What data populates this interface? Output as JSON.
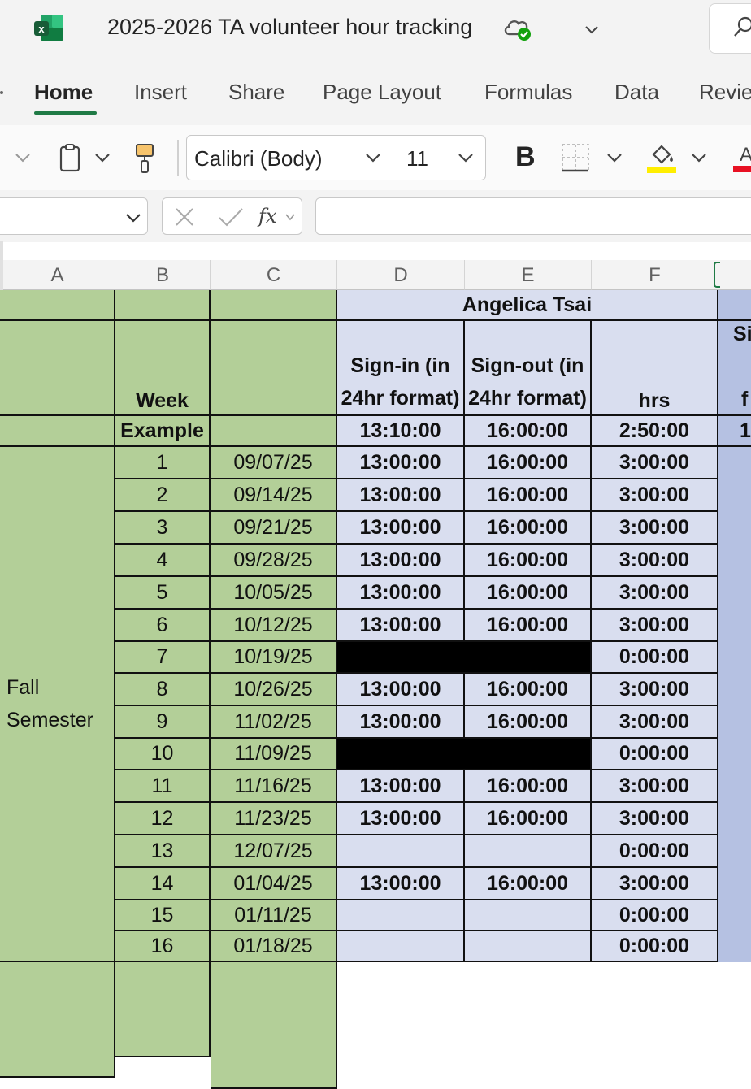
{
  "window": {
    "title": "2025-2026 TA volunteer hour tracking",
    "logo_icon": "excel-logo-icon",
    "sync_icon": "cloud-saved-icon"
  },
  "tabs": [
    "Home",
    "Insert",
    "Share",
    "Page Layout",
    "Formulas",
    "Data",
    "Revie"
  ],
  "active_tab": "Home",
  "ribbon": {
    "font_name": "Calibri (Body)",
    "font_size": "11",
    "bold_label": "B",
    "highlight_color": "#ffee00",
    "font_color": "#e81123",
    "accent": "#1f7a45"
  },
  "formula_bar": {
    "fx_label": "fx",
    "name_box": "",
    "formula": ""
  },
  "columns": [
    "A",
    "B",
    "C",
    "D",
    "E",
    "F"
  ],
  "sheet": {
    "person": "Angelica Tsai",
    "hdr_week": "Week",
    "hdr_signin": "Sign-in (in 24hr format)",
    "hdr_signout": "Sign-out (in 24hr format)",
    "hdr_hrs": "hrs",
    "next_hdr_top": "Si",
    "next_hdr_bottom": "f",
    "example_label": "Example",
    "example_in": "13:10:00",
    "example_out": "16:00:00",
    "example_hrs": "2:50:00",
    "example_next": "1",
    "semester_label": "Fall Semester",
    "rows": [
      {
        "week": "1",
        "date": "09/07/25",
        "in": "13:00:00",
        "out": "16:00:00",
        "hrs": "3:00:00",
        "blocked": false
      },
      {
        "week": "2",
        "date": "09/14/25",
        "in": "13:00:00",
        "out": "16:00:00",
        "hrs": "3:00:00",
        "blocked": false
      },
      {
        "week": "3",
        "date": "09/21/25",
        "in": "13:00:00",
        "out": "16:00:00",
        "hrs": "3:00:00",
        "blocked": false
      },
      {
        "week": "4",
        "date": "09/28/25",
        "in": "13:00:00",
        "out": "16:00:00",
        "hrs": "3:00:00",
        "blocked": false
      },
      {
        "week": "5",
        "date": "10/05/25",
        "in": "13:00:00",
        "out": "16:00:00",
        "hrs": "3:00:00",
        "blocked": false
      },
      {
        "week": "6",
        "date": "10/12/25",
        "in": "13:00:00",
        "out": "16:00:00",
        "hrs": "3:00:00",
        "blocked": false
      },
      {
        "week": "7",
        "date": "10/19/25",
        "in": "",
        "out": "",
        "hrs": "0:00:00",
        "blocked": true
      },
      {
        "week": "8",
        "date": "10/26/25",
        "in": "13:00:00",
        "out": "16:00:00",
        "hrs": "3:00:00",
        "blocked": false
      },
      {
        "week": "9",
        "date": "11/02/25",
        "in": "13:00:00",
        "out": "16:00:00",
        "hrs": "3:00:00",
        "blocked": false
      },
      {
        "week": "10",
        "date": "11/09/25",
        "in": "",
        "out": "",
        "hrs": "0:00:00",
        "blocked": true
      },
      {
        "week": "11",
        "date": "11/16/25",
        "in": "13:00:00",
        "out": "16:00:00",
        "hrs": "3:00:00",
        "blocked": false
      },
      {
        "week": "12",
        "date": "11/23/25",
        "in": "13:00:00",
        "out": "16:00:00",
        "hrs": "3:00:00",
        "blocked": false
      },
      {
        "week": "13",
        "date": "12/07/25",
        "in": "",
        "out": "",
        "hrs": "0:00:00",
        "blocked": false
      },
      {
        "week": "14",
        "date": "01/04/25",
        "in": "13:00:00",
        "out": "16:00:00",
        "hrs": "3:00:00",
        "blocked": false
      },
      {
        "week": "15",
        "date": "01/11/25",
        "in": "",
        "out": "",
        "hrs": "0:00:00",
        "blocked": false
      },
      {
        "week": "16",
        "date": "01/18/25",
        "in": "",
        "out": "",
        "hrs": "0:00:00",
        "blocked": false
      }
    ]
  }
}
